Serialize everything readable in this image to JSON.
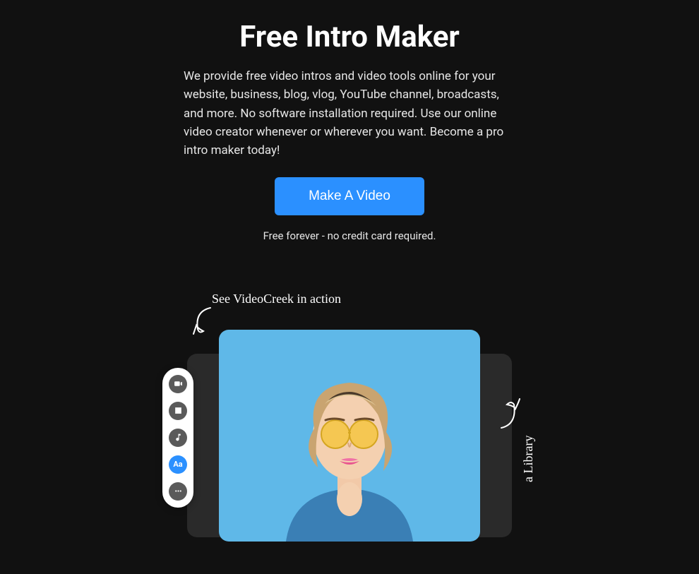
{
  "hero": {
    "title": "Free Intro Maker",
    "description": "We provide free video intros and video tools online for your website, business, blog, vlog, YouTube channel, broadcasts, and more. No software installation required. Use our online video creator whenever or wherever you want. Become a pro intro maker today!",
    "cta_label": "Make A Video",
    "subnote": "Free forever - no credit card required."
  },
  "demo": {
    "see_action_label": "See VideoCreek in action",
    "media_library_label": "a Library"
  },
  "toolbar": {
    "items": [
      {
        "name": "video-icon",
        "active": false
      },
      {
        "name": "image-icon",
        "active": false
      },
      {
        "name": "music-icon",
        "active": false
      },
      {
        "name": "text-icon",
        "active": true,
        "glyph": "Aa"
      },
      {
        "name": "more-icon",
        "active": false
      }
    ]
  },
  "colors": {
    "accent": "#2b90ff",
    "bg": "#111111",
    "video_bg": "#5fb8e8"
  }
}
